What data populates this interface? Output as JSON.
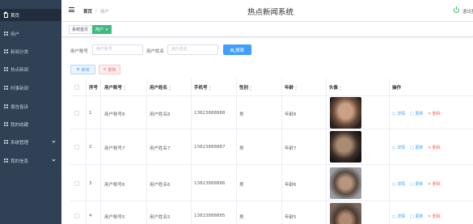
{
  "sidebar": {
    "items": [
      {
        "label": "首页",
        "icon": "home-icon"
      },
      {
        "label": "用户",
        "icon": "grid-icon"
      },
      {
        "label": "新闻分类",
        "icon": "grid-icon"
      },
      {
        "label": "热点新闻",
        "icon": "grid-icon"
      },
      {
        "label": "时事新闻",
        "icon": "grid-icon"
      },
      {
        "label": "报告投诉",
        "icon": "grid-icon"
      },
      {
        "label": "我的收藏",
        "icon": "grid-icon"
      },
      {
        "label": "系统管理",
        "icon": "grid-icon"
      },
      {
        "label": "我的信息",
        "icon": "grid-icon"
      }
    ]
  },
  "header": {
    "breadcrumb_home": "首页",
    "breadcrumb_sep": "/",
    "breadcrumb_current": "用户",
    "title": "热点新闻系统",
    "logout": "退出登录"
  },
  "tags": {
    "home": "系统首页",
    "current": "用户",
    "close": "×"
  },
  "search": {
    "account_label": "用户账号",
    "account_placeholder": "用户账号",
    "name_label": "用户姓名",
    "name_placeholder": "用户姓名",
    "button": "搜索"
  },
  "actions": {
    "add": "新增",
    "delete": "删除"
  },
  "table": {
    "headers": [
      "序号",
      "用户账号",
      "用户姓名",
      "手机号",
      "性别",
      "年龄",
      "头像",
      "操作"
    ],
    "rows": [
      {
        "index": "1",
        "account": "用户账号8",
        "name": "用户姓名8",
        "phone": "13823888888",
        "gender": "男",
        "age": "年龄8"
      },
      {
        "index": "2",
        "account": "用户账号7",
        "name": "用户姓名7",
        "phone": "13823888887",
        "gender": "男",
        "age": "年龄7"
      },
      {
        "index": "3",
        "account": "用户账号6",
        "name": "用户姓名6",
        "phone": "13823888886",
        "gender": "男",
        "age": "年龄6"
      },
      {
        "index": "4",
        "account": "用户账号5",
        "name": "用户姓名5",
        "phone": "13823888885",
        "gender": "男",
        "age": "年龄5"
      }
    ],
    "op_detail": "详情",
    "op_update": "更新",
    "op_delete": "删除"
  },
  "colors": {
    "sidebar_bg": "#304156",
    "accent": "#409eff",
    "tag_active": "#42b983",
    "danger": "#f56c6c"
  }
}
